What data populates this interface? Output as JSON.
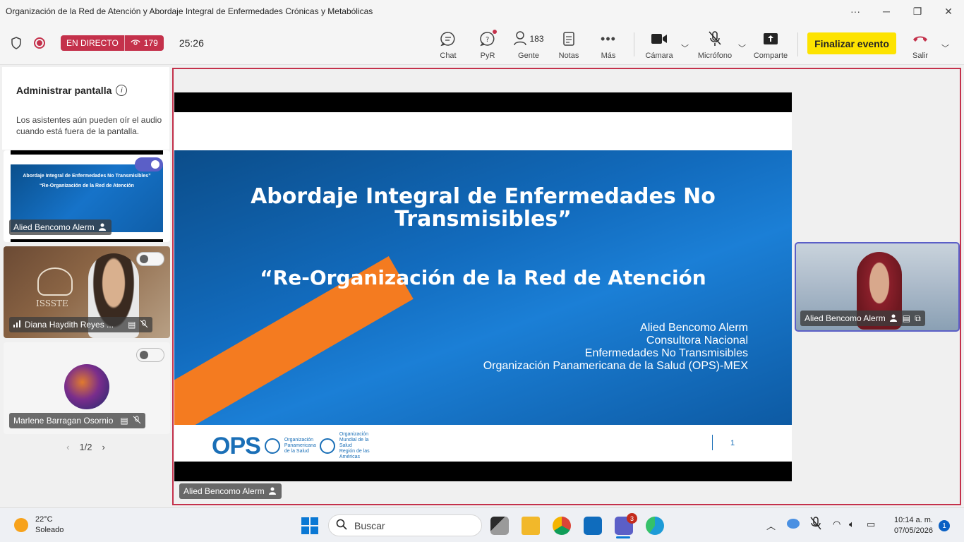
{
  "window": {
    "title": "Organización de la Red de Atención y Abordaje Integral de Enfermedades Crónicas y Metabólicas",
    "more": "···",
    "minimize": "─",
    "maximize": "❐",
    "close": "✕"
  },
  "toolbar": {
    "live_label": "EN DIRECTO",
    "viewer_count": "179",
    "timer": "25:26",
    "chat_label": "Chat",
    "qa_label": "PyR",
    "people_label": "Gente",
    "people_count": "183",
    "notes_label": "Notas",
    "more_label": "Más",
    "camera_label": "Cámara",
    "mic_label": "Micrófono",
    "share_label": "Comparte",
    "end_event_label": "Finalizar evento",
    "leave_label": "Salir",
    "colors": {
      "live": "#c4314b",
      "end_button": "#fde300",
      "accent": "#5b5fc7"
    }
  },
  "left_panel": {
    "manage_title": "Administrar pantalla",
    "manage_desc": "Los asistentes aún pueden oír el audio cuando está fuera de la pantalla.",
    "tiles": [
      {
        "name": "Alied Bencomo Alerm",
        "toggle_on": true
      },
      {
        "name": "Diana Haydith Reyes ...",
        "toggle_on": false
      },
      {
        "name": "Marlene Barragan Osornio",
        "toggle_on": false
      }
    ],
    "mini_slide": {
      "line1": "Abordaje Integral de Enfermedades No Transmisibles”",
      "line2": "“Re-Organización de la Red de Atención"
    },
    "pager": "1/2"
  },
  "stage": {
    "slide_title": "Abordaje Integral de Enfermedades No Transmisibles”",
    "slide_subtitle": "“Re-Organización de la Red de Atención",
    "authors": [
      "Alied Bencomo Alerm",
      "Consultora Nacional",
      "Enfermedades No Transmisibles",
      "Organización Panamericana de la Salud (OPS)-MEX"
    ],
    "logo_text": "OPS",
    "org1": "Organización Panamericana de la Salud",
    "org2": "Organización Mundial de la Salud",
    "org2_region": "Región de las Américas",
    "page_number": "1",
    "presenter_name": "Alied Bencomo Alerm",
    "presenter_tile_name": "Alied Bencomo Alerm"
  },
  "taskbar": {
    "temperature": "22°C",
    "weather": "Soleado",
    "search_placeholder": "Buscar",
    "teams_badge": "3",
    "time": "10:14 a. m.",
    "date": "07/05/2026",
    "notifications": "1"
  }
}
